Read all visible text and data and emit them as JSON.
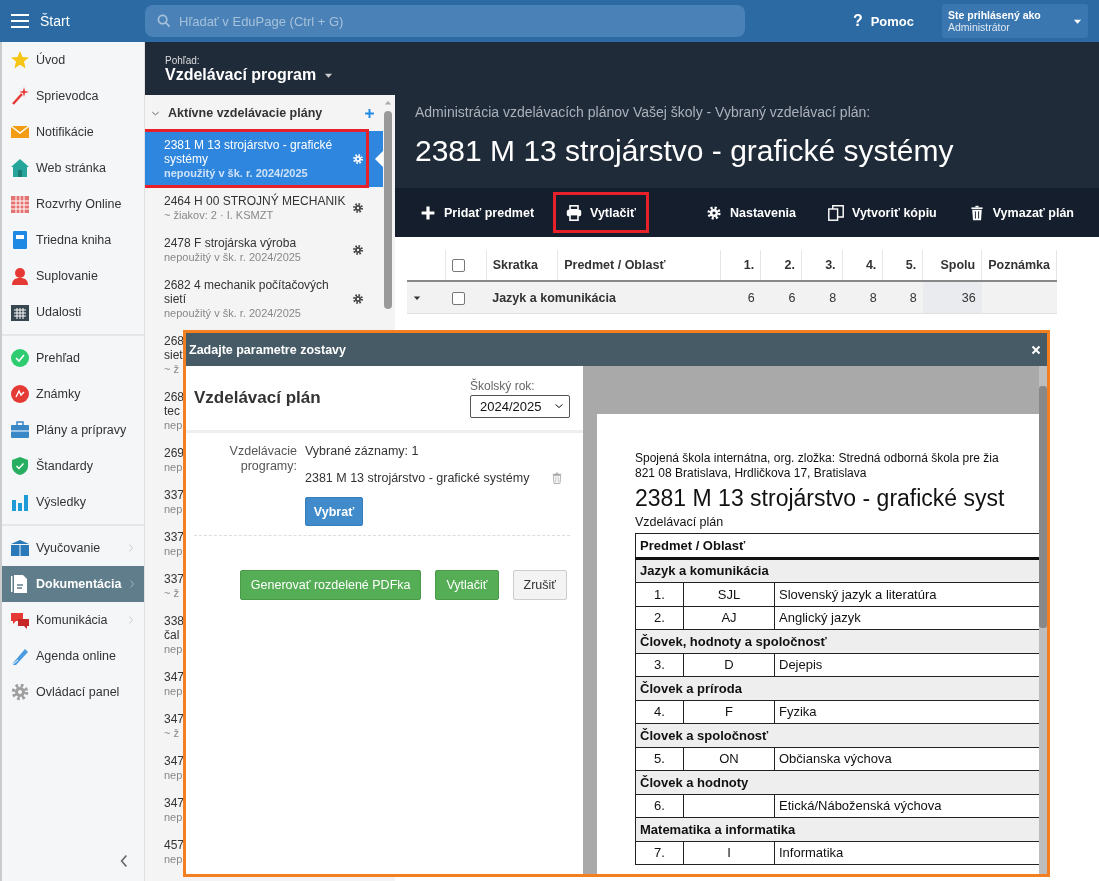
{
  "top_bar": {
    "menu_label": "Štart",
    "search": {
      "placeholder": "Hľadať v EduPage (Ctrl + G)"
    },
    "help": {
      "icon": "?",
      "label": "Pomoc"
    },
    "user": {
      "caption": "Ste prihlásený ako",
      "name": "Administrátor"
    }
  },
  "sidebar": {
    "groups": [
      [
        {
          "label": "Úvod",
          "selected": false,
          "has_submenu": false
        },
        {
          "label": "Sprievodca",
          "selected": false,
          "has_submenu": false
        },
        {
          "label": "Notifikácie",
          "selected": false,
          "has_submenu": false
        },
        {
          "label": "Web stránka",
          "selected": false,
          "has_submenu": false
        },
        {
          "label": "Rozvrhy Online",
          "selected": false,
          "has_submenu": false
        },
        {
          "label": "Triedna kniha",
          "selected": false,
          "has_submenu": false
        },
        {
          "label": "Suplovanie",
          "selected": false,
          "has_submenu": false
        },
        {
          "label": "Udalosti",
          "selected": false,
          "has_submenu": false
        }
      ],
      [
        {
          "label": "Prehľad",
          "selected": false,
          "has_submenu": false
        },
        {
          "label": "Známky",
          "selected": false,
          "has_submenu": false
        },
        {
          "label": "Plány a prípravy",
          "selected": false,
          "has_submenu": false
        },
        {
          "label": "Štandardy",
          "selected": false,
          "has_submenu": false
        },
        {
          "label": "Výsledky",
          "selected": false,
          "has_submenu": false
        }
      ],
      [
        {
          "label": "Vyučovanie",
          "selected": false,
          "has_submenu": true
        },
        {
          "label": "Dokumentácia",
          "selected": true,
          "has_submenu": true
        },
        {
          "label": "Komunikácia",
          "selected": false,
          "has_submenu": true
        },
        {
          "label": "Agenda online",
          "selected": false,
          "has_submenu": false
        },
        {
          "label": "Ovládací panel",
          "selected": false,
          "has_submenu": false
        }
      ]
    ]
  },
  "view": {
    "caption": "Pohľad:",
    "value": "Vzdelávací program"
  },
  "plan_list": {
    "section": "Aktívne vzdelávacie plány",
    "expanded": true,
    "items": [
      {
        "lines": [
          "2381 M 13 strojárstvo - grafické systémy"
        ],
        "note": "nepoužitý v šk. r. 2024/2025",
        "selected": true,
        "highlighted": true,
        "has_gear": true
      },
      {
        "lines": [
          "2464 H 00 STROJNÝ MECHANIK"
        ],
        "note": "~ žiakov: 2 · I. KSMZT",
        "selected": false,
        "highlighted": false,
        "has_gear": true
      },
      {
        "lines": [
          "2478 F strojárska výroba"
        ],
        "note": "nepoužitý v šk. r. 2024/2025",
        "selected": false,
        "highlighted": false,
        "has_gear": true
      },
      {
        "lines": [
          "2682 4 mechanik počítačových sietí"
        ],
        "note": "nepoužitý v šk. r. 2024/2025",
        "selected": false,
        "highlighted": false,
        "has_gear": true
      },
      {
        "lines": [
          "268",
          "siet"
        ],
        "note": "~ ž",
        "selected": false,
        "highlighted": false,
        "has_gear": false
      },
      {
        "lines": [
          "268",
          "tec"
        ],
        "note": "nep",
        "selected": false,
        "highlighted": false,
        "has_gear": false
      },
      {
        "lines": [
          "269"
        ],
        "note": "nep",
        "selected": false,
        "highlighted": false,
        "has_gear": false
      },
      {
        "lines": [
          "337"
        ],
        "note": "nep",
        "selected": false,
        "highlighted": false,
        "has_gear": false
      },
      {
        "lines": [
          "337"
        ],
        "note": "nep",
        "selected": false,
        "highlighted": false,
        "has_gear": false
      },
      {
        "lines": [
          "337"
        ],
        "note": "~ ž",
        "selected": false,
        "highlighted": false,
        "has_gear": false
      },
      {
        "lines": [
          "338",
          "čal"
        ],
        "note": "nep",
        "selected": false,
        "highlighted": false,
        "has_gear": false
      },
      {
        "lines": [
          "347"
        ],
        "note": "nep",
        "selected": false,
        "highlighted": false,
        "has_gear": false
      },
      {
        "lines": [
          "347"
        ],
        "note": "~ ž",
        "selected": false,
        "highlighted": false,
        "has_gear": false
      },
      {
        "lines": [
          "347"
        ],
        "note": "nep",
        "selected": false,
        "highlighted": false,
        "has_gear": false
      },
      {
        "lines": [
          "347"
        ],
        "note": "nep",
        "selected": false,
        "highlighted": false,
        "has_gear": false
      },
      {
        "lines": [
          "457"
        ],
        "note": "nep",
        "selected": false,
        "highlighted": false,
        "has_gear": false
      }
    ]
  },
  "main": {
    "caption": "Administrácia vzdelávacích plánov Vašej školy - Vybraný vzdelávací plán:",
    "title": "2381 M 13 strojárstvo - grafické systémy",
    "toolbar": {
      "left": [
        {
          "label": "Pridať predmet",
          "highlighted": false
        },
        {
          "label": "Vytlačiť",
          "highlighted": true
        }
      ],
      "right": [
        {
          "label": "Nastavenia",
          "highlighted": false
        },
        {
          "label": "Vytvoriť kópiu",
          "highlighted": false
        },
        {
          "label": "Vymazať plán",
          "highlighted": false
        }
      ]
    },
    "table": {
      "checked": false,
      "columns": [
        "Skratka",
        "Predmet / Oblasť",
        "1.",
        "2.",
        "3.",
        "4.",
        "5.",
        "Spolu",
        "Poznámka"
      ],
      "rows": [
        {
          "kind": "group",
          "expanded": true,
          "checked": false,
          "label": "Jazyk a komunikácia",
          "values": [
            "6",
            "6",
            "8",
            "8",
            "8",
            "36"
          ]
        }
      ]
    }
  },
  "dialog": {
    "title": "Zadajte parametre zostavy",
    "highlighted": true,
    "heading": "Vzdelávací plán",
    "year": {
      "label": "Školský rok:",
      "value": "2024/2025"
    },
    "field_label": "Vzdelávacie programy:",
    "selected_count": "Vybrané záznamy: 1",
    "selected_items": [
      "2381 M 13 strojárstvo - grafické systémy"
    ],
    "choose_button": "Vybrať",
    "buttons": [
      {
        "label": "Generovať rozdelené PDFka",
        "kind": "primary"
      },
      {
        "label": "Vytlačiť",
        "kind": "primary"
      },
      {
        "label": "Zrušiť",
        "kind": "secondary"
      }
    ],
    "preview": {
      "school": "Spojená škola internátna, org. zložka: Stredná odborná škola pre žia",
      "address": "821 08 Bratislava, Hrdličkova 17, Bratislava",
      "title": "2381 M 13 strojárstvo - grafické syst",
      "subtitle": "Vzdelávací plán",
      "header": "Predmet / Oblasť",
      "rows": [
        {
          "kind": "group",
          "label": "Jazyk a komunikácia"
        },
        {
          "kind": "subject",
          "number": "1.",
          "code": "SJL",
          "name": "Slovenský jazyk a literatúra"
        },
        {
          "kind": "subject",
          "number": "2.",
          "code": "AJ",
          "name": "Anglický jazyk"
        },
        {
          "kind": "group",
          "label": "Človek, hodnoty a spoločnosť"
        },
        {
          "kind": "subject",
          "number": "3.",
          "code": "D",
          "name": "Dejepis"
        },
        {
          "kind": "group",
          "label": "Človek a príroda"
        },
        {
          "kind": "subject",
          "number": "4.",
          "code": "F",
          "name": "Fyzika"
        },
        {
          "kind": "group",
          "label": "Človek a spoločnosť"
        },
        {
          "kind": "subject",
          "number": "5.",
          "code": "ON",
          "name": "Občianska výchova"
        },
        {
          "kind": "group",
          "label": "Človek a hodnoty"
        },
        {
          "kind": "subject",
          "number": "6.",
          "name": "Etická/Náboženská výchova"
        },
        {
          "kind": "group",
          "label": "Matematika a informatika"
        },
        {
          "kind": "subject",
          "number": "7.",
          "code": "I",
          "name": "Informatika"
        }
      ]
    }
  }
}
